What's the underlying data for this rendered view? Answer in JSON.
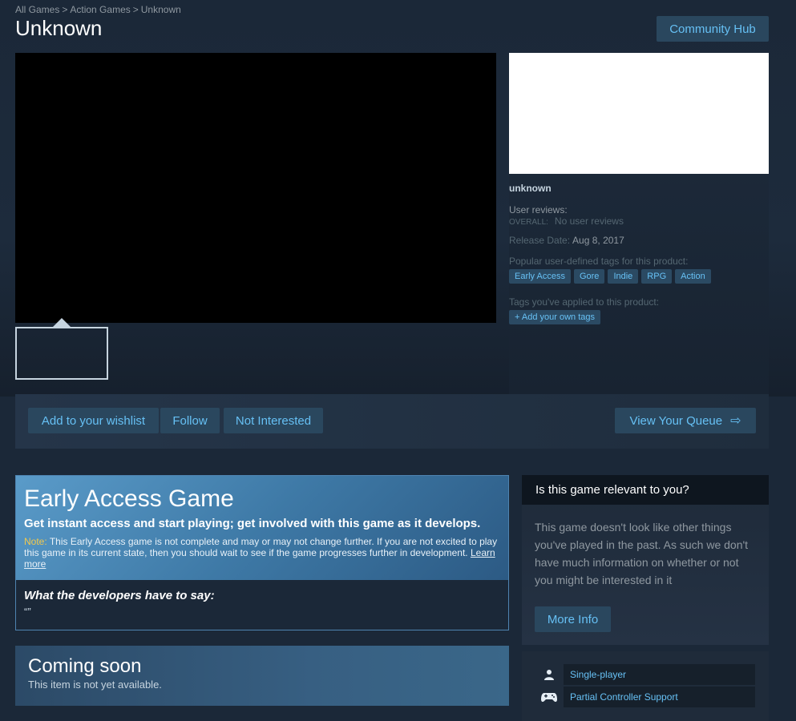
{
  "breadcrumb": [
    "All Games",
    "Action Games",
    "Unknown"
  ],
  "breadcrumb_sep": ">",
  "title": "Unknown",
  "community_hub": "Community Hub",
  "game_info": {
    "name": "unknown",
    "reviews_label": "User reviews:",
    "overall_label": "OVERALL:",
    "overall_value": "No user reviews",
    "release_label": "Release Date:",
    "release_date": "Aug 8, 2017",
    "tags_label": "Popular user-defined tags for this product:",
    "tags": [
      "Early Access",
      "Gore",
      "Indie",
      "RPG",
      "Action"
    ],
    "applied_label": "Tags you've applied to this product:",
    "add_tags": "+ Add your own tags"
  },
  "queue": {
    "wishlist": "Add to your wishlist",
    "follow": "Follow",
    "not_interested": "Not Interested",
    "view_queue": "View Your Queue",
    "arrow_icon": "⇨"
  },
  "early_access": {
    "title": "Early Access Game",
    "subtitle": "Get instant access and start playing; get involved with this game as it develops.",
    "note_label": "Note:",
    "note_text": "This Early Access game is not complete and may or may not change further. If you are not excited to play this game in its current state, then you should wait to see if the game progresses further in development.",
    "learn_more": "Learn more",
    "dev_title": "What the developers have to say:",
    "dev_quote": "“”"
  },
  "coming_soon": {
    "title": "Coming soon",
    "subtitle": "This item is not yet available."
  },
  "relevance": {
    "title": "Is this game relevant to you?",
    "text": "This game doesn't look like other things you've played in the past. As such we don't have much information on whether or not you might be interested in it",
    "more_info": "More Info"
  },
  "features": [
    {
      "icon": "single-player-icon",
      "label": "Single-player"
    },
    {
      "icon": "controller-icon",
      "label": "Partial Controller Support"
    }
  ],
  "colors": {
    "background": "#1b2838",
    "accent": "#66c0f4",
    "button": "#2a475e"
  }
}
